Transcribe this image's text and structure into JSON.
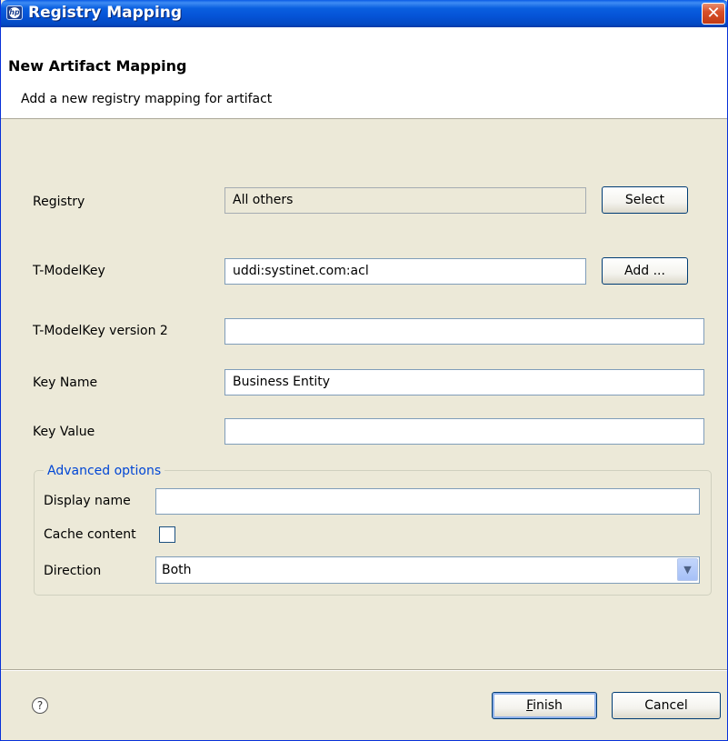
{
  "window": {
    "title": "Registry Mapping",
    "close_symbol": "✕"
  },
  "header": {
    "title": "New Artifact Mapping",
    "subtitle": "Add a new registry mapping for artifact"
  },
  "form": {
    "registry": {
      "label": "Registry",
      "value": "All others",
      "button": "Select"
    },
    "tmodelkey": {
      "label": "T-ModelKey",
      "value": "uddi:systinet.com:acl",
      "button": "Add ..."
    },
    "tmodelkey_v2": {
      "label": "T-ModelKey version 2",
      "value": ""
    },
    "key_name": {
      "label": "Key Name",
      "value": "Business Entity"
    },
    "key_value": {
      "label": "Key Value",
      "value": ""
    }
  },
  "advanced": {
    "legend": "Advanced options",
    "display_name": {
      "label": "Display name",
      "value": ""
    },
    "cache_content": {
      "label": "Cache content",
      "checked": false
    },
    "direction": {
      "label": "Direction",
      "value": "Both"
    }
  },
  "footer": {
    "help_symbol": "?",
    "finish_mnemonic": "F",
    "finish_rest": "inish",
    "cancel": "Cancel"
  }
}
